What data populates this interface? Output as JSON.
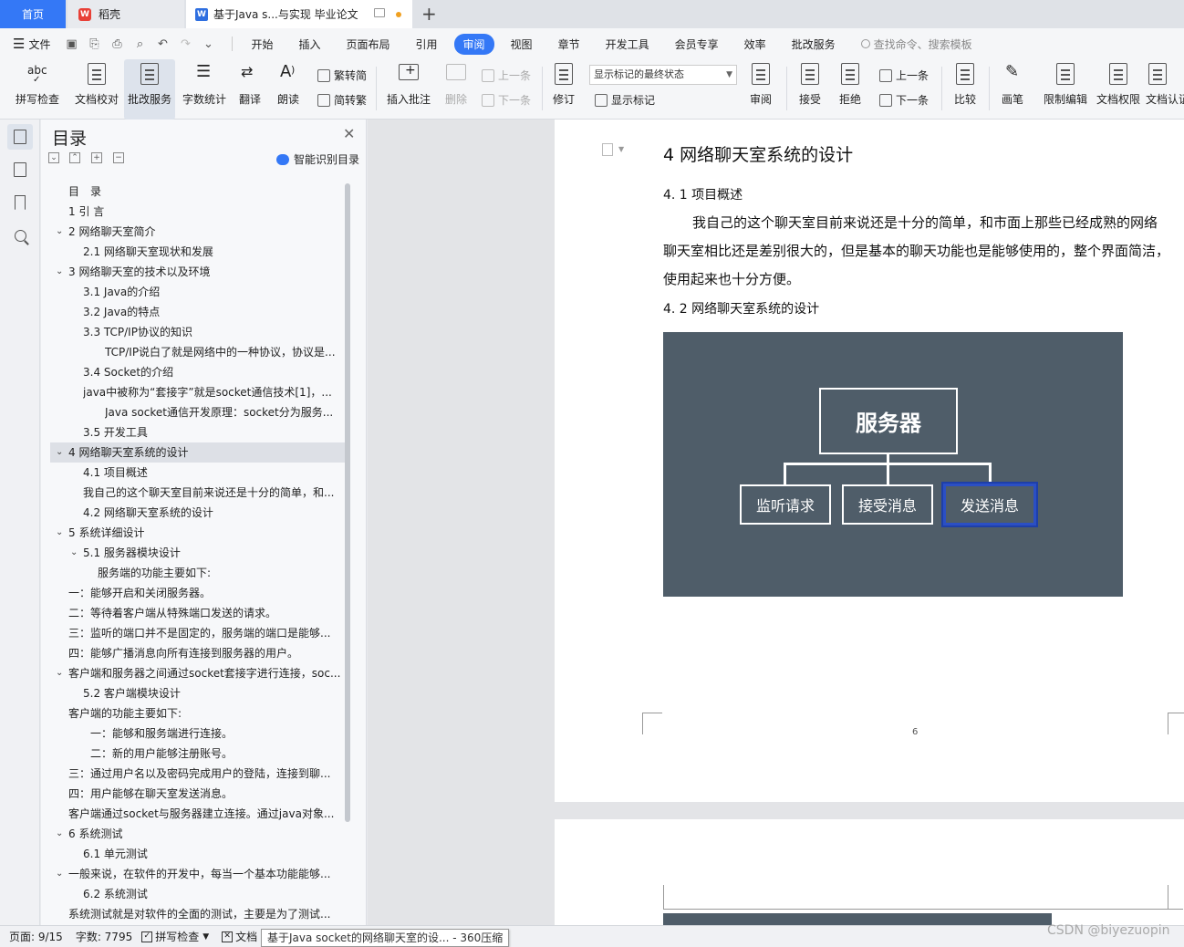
{
  "tabs": {
    "home": "首页",
    "wps": "稻壳",
    "doc": "基于Java s...与实现 毕业论文"
  },
  "menu": {
    "file": "文件",
    "tabs": [
      "开始",
      "插入",
      "页面布局",
      "引用",
      "审阅",
      "视图",
      "章节",
      "开发工具",
      "会员专享",
      "效率",
      "批改服务"
    ],
    "active_tab": "审阅",
    "search": "查找命令、搜索模板"
  },
  "ribbon": {
    "spell": "拼写检查",
    "proofread": "文档校对",
    "grading": "批改服务",
    "wordcount": "字数统计",
    "translate": "翻译",
    "read": "朗读",
    "trad": "繁转简",
    "simp": "简转繁",
    "insert_comment": "插入批注",
    "delete": "删除",
    "prev": "上一条",
    "next": "下一条",
    "revise": "修订",
    "markup_state": "显示标记的最终状态",
    "show_markup": "显示标记",
    "review": "审阅",
    "accept": "接受",
    "reject": "拒绝",
    "prev2": "上一条",
    "next2": "下一条",
    "compare": "比较",
    "pen": "画笔",
    "restrict": "限制编辑",
    "permission": "文档权限",
    "cert": "文档认证"
  },
  "toc": {
    "title": "目录",
    "smart": "智能识别目录",
    "items": [
      {
        "text": "目　录",
        "level": 0,
        "caret": ""
      },
      {
        "text": "1 引 言",
        "level": 0,
        "caret": ""
      },
      {
        "text": "2  网络聊天室简介",
        "level": 0,
        "caret": "v"
      },
      {
        "text": "2.1  网络聊天室现状和发展",
        "level": 1,
        "caret": ""
      },
      {
        "text": "3 网络聊天室的技术以及环境",
        "level": 0,
        "caret": "v"
      },
      {
        "text": "3.1 Java的介绍",
        "level": 1,
        "caret": ""
      },
      {
        "text": "3.2 Java的特点",
        "level": 1,
        "caret": ""
      },
      {
        "text": "3.3 TCP/IP协议的知识",
        "level": 1,
        "caret": ""
      },
      {
        "text": "TCP/IP说白了就是网络中的一种协议，协议是...",
        "level": 2,
        "caret": ""
      },
      {
        "text": "3.4 Socket的介绍",
        "level": 1,
        "caret": ""
      },
      {
        "text": "java中被称为“套接字”就是socket通信技术[1]，...",
        "level": 1,
        "caret": ""
      },
      {
        "text": "Java socket通信开发原理：socket分为服务...",
        "level": 2,
        "caret": ""
      },
      {
        "text": "3.5  开发工具",
        "level": 1,
        "caret": ""
      },
      {
        "text": "4  网络聊天室系统的设计",
        "level": 0,
        "caret": "v"
      },
      {
        "text": "4.1  项目概述",
        "level": 1,
        "caret": ""
      },
      {
        "text": "我自己的这个聊天室目前来说还是十分的简单，和...",
        "level": 1,
        "caret": ""
      },
      {
        "text": "4.2  网络聊天室系统的设计",
        "level": 1,
        "caret": ""
      },
      {
        "text": "5  系统详细设计",
        "level": 0,
        "caret": "v"
      },
      {
        "text": "5.1  服务器模块设计",
        "level": 1,
        "caret": "v"
      },
      {
        "text": "服务端的功能主要如下:",
        "level": 15,
        "caret": ""
      },
      {
        "text": "一：能够开启和关闭服务器。",
        "level": 0,
        "caret": ""
      },
      {
        "text": "二：等待着客户端从特殊端口发送的请求。",
        "level": 0,
        "caret": ""
      },
      {
        "text": "三：监听的端口并不是固定的，服务端的端口是能够...",
        "level": 0,
        "caret": ""
      },
      {
        "text": "四：能够广播消息向所有连接到服务器的用户。",
        "level": 0,
        "caret": ""
      },
      {
        "text": "客户端和服务器之间通过socket套接字进行连接，soc...",
        "level": 0,
        "caret": "v"
      },
      {
        "text": "5.2  客户端模块设计",
        "level": 1,
        "caret": ""
      },
      {
        "text": "客户端的功能主要如下:",
        "level": 0,
        "caret": ""
      },
      {
        "text": "一：能够和服务端进行连接。",
        "level": 3,
        "caret": ""
      },
      {
        "text": "二：新的用户能够注册账号。",
        "level": 3,
        "caret": ""
      },
      {
        "text": "三：通过用户名以及密码完成用户的登陆，连接到聊...",
        "level": 0,
        "caret": ""
      },
      {
        "text": "四：用户能够在聊天室发送消息。",
        "level": 0,
        "caret": ""
      },
      {
        "text": "客户端通过socket与服务器建立连接。通过java对象...",
        "level": 0,
        "caret": ""
      },
      {
        "text": "6  系统测试",
        "level": 0,
        "caret": "v"
      },
      {
        "text": "6.1  单元测试",
        "level": 1,
        "caret": ""
      },
      {
        "text": "一般来说，在软件的开发中，每当一个基本功能能够...",
        "level": 0,
        "caret": "v"
      },
      {
        "text": "6.2  系统测试",
        "level": 1,
        "caret": ""
      },
      {
        "text": "系统测试就是对软件的全面的测试，主要是为了测试...",
        "level": 0,
        "caret": ""
      }
    ],
    "selected_index": 13
  },
  "document": {
    "heading": "4  网络聊天室系统的设计",
    "sub1": "4. 1  项目概述",
    "paragraph": "我自己的这个聊天室目前来说还是十分的简单，和市面上那些已经成熟的网络聊天室相比还是差别很大的，但是基本的聊天功能也是能够使用的，整个界面简洁，使用起来也十分方便。",
    "sub2": "4. 2  网络聊天室系统的设计",
    "diagram": {
      "root": "服务器",
      "children": [
        "监听请求",
        "接受消息",
        "发送消息"
      ]
    },
    "page_number": "6"
  },
  "status": {
    "page": "页面: 9/15",
    "words": "字数: 7795",
    "spell": "拼写检查",
    "doc": "文档",
    "tooltip": "基于Java socket的网络聊天室的设... - 360压缩",
    "watermark": "CSDN @biyezuopin"
  },
  "colors": {
    "accent": "#3478f6",
    "diagram_bg": "#4f5d69",
    "selection": "#2b4fc4"
  }
}
